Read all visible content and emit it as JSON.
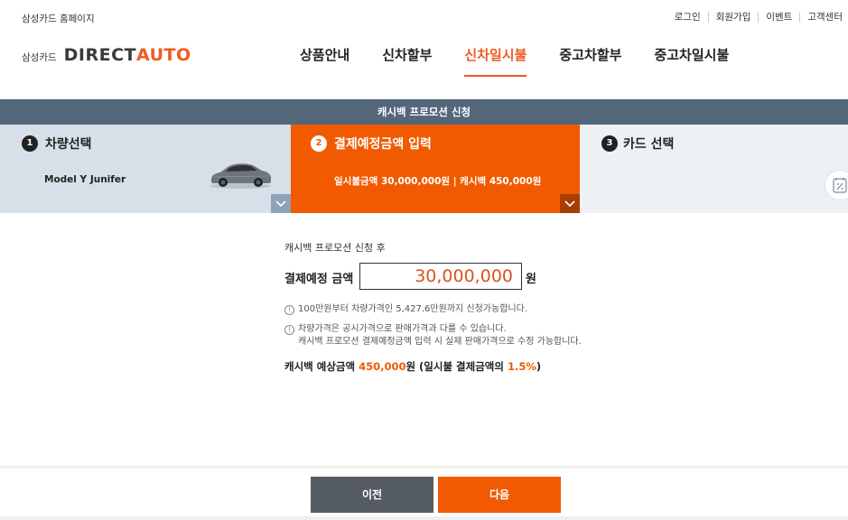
{
  "util": {
    "home_link": "삼성카드 홈페이지",
    "links": [
      "로그인",
      "회원가입",
      "이벤트",
      "고객센터"
    ]
  },
  "logo": {
    "brand_small": "삼성카드",
    "direct": "DIRECT",
    "auto": "AUTO"
  },
  "nav": {
    "items": [
      "상품안내",
      "신차할부",
      "신차일시불",
      "중고차할부",
      "중고차일시불"
    ],
    "active_index": 2
  },
  "promo_bar": {
    "title": "캐시백 프로모션 신청"
  },
  "steps": [
    {
      "num": "1",
      "title": "차량선택",
      "detail": "Model Y Junifer"
    },
    {
      "num": "2",
      "title": "결제예정금액 입력",
      "detail": "일시불금액 30,000,000원  |  캐시백 450,000원"
    },
    {
      "num": "3",
      "title": "카드 선택"
    }
  ],
  "content": {
    "caption": "캐시백 프로모션 신청 후",
    "amount_label": "결제예정 금액",
    "amount_value": "30,000,000",
    "currency": "원",
    "notes": [
      "100만원부터 차량가격인 5,427.6만원까지 신청가능합니다.",
      "차량가격은 공시가격으로 판매가격과 다를 수 있습니다.",
      "캐시백 프로모션 결제예정금액 입력 시 실제 판매가격으로 수정 가능합니다."
    ],
    "cashback_prefix": "캐시백 예상금액 ",
    "cashback_value": "450,000",
    "cashback_mid": "원 (일시불 결제금액의 ",
    "cashback_rate": "1.5%",
    "cashback_suffix": ")"
  },
  "buttons": {
    "prev": "이전",
    "next": "다음"
  },
  "colors": {
    "accent": "#f15a00",
    "promo_bar": "#54667a",
    "step1_bg": "#d7e0e8",
    "step3_bg": "#eef1f4",
    "prev_btn": "#555b63"
  }
}
